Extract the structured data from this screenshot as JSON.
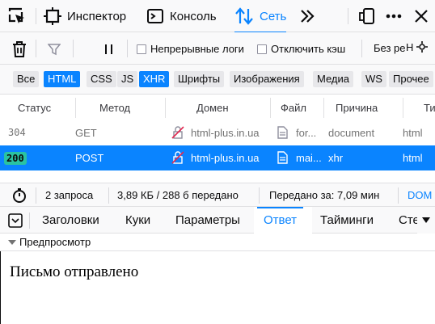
{
  "toolbar": {
    "tabs": [
      {
        "label": "Инспектор",
        "icon": "inspector-icon"
      },
      {
        "label": "Консоль",
        "icon": "console-icon"
      },
      {
        "label": "Сеть",
        "icon": "network-icon"
      }
    ],
    "more_tabs_icon": "chevron-double-right-icon",
    "right_icons": [
      "responsive-design-icon",
      "more-options-icon",
      "close-icon"
    ]
  },
  "net_toolbar": {
    "persist_logs": "Непрерывные логи",
    "disable_cache": "Отключить кэш",
    "throttling": "Без ре",
    "throttling_more": "Н"
  },
  "filters": {
    "buttons": [
      "Все",
      "HTML",
      "CSS",
      "JS",
      "XHR",
      "Шрифты",
      "Изображения",
      "Медиа",
      "WS",
      "Прочее"
    ],
    "active": [
      "HTML",
      "XHR"
    ]
  },
  "columns": [
    "Статус",
    "Метод",
    "Домен",
    "Файл",
    "Причина",
    "Ти"
  ],
  "requests": [
    {
      "status": "304",
      "method": "GET",
      "domain": "html-plus.in.ua",
      "file": "for...",
      "cause": "document",
      "type": "html"
    },
    {
      "status": "200",
      "method": "POST",
      "domain": "html-plus.in.ua",
      "file": "mai...",
      "cause": "xhr",
      "type": "html"
    }
  ],
  "summary": {
    "requests": "2 запроса",
    "transferred": "3,89 КБ / 288 б передано",
    "finish": "Передано за: 7,09 мин",
    "dom": "DOM"
  },
  "details_tabs": [
    "Заголовки",
    "Куки",
    "Параметры",
    "Ответ",
    "Тайминги",
    "Сте"
  ],
  "details_selected": "Ответ",
  "preview": {
    "label": "Предпросмотр",
    "text": "Письмо отправлено"
  },
  "colors": {
    "accent": "#0a84ff",
    "status_ok": "#2ac3a2"
  }
}
